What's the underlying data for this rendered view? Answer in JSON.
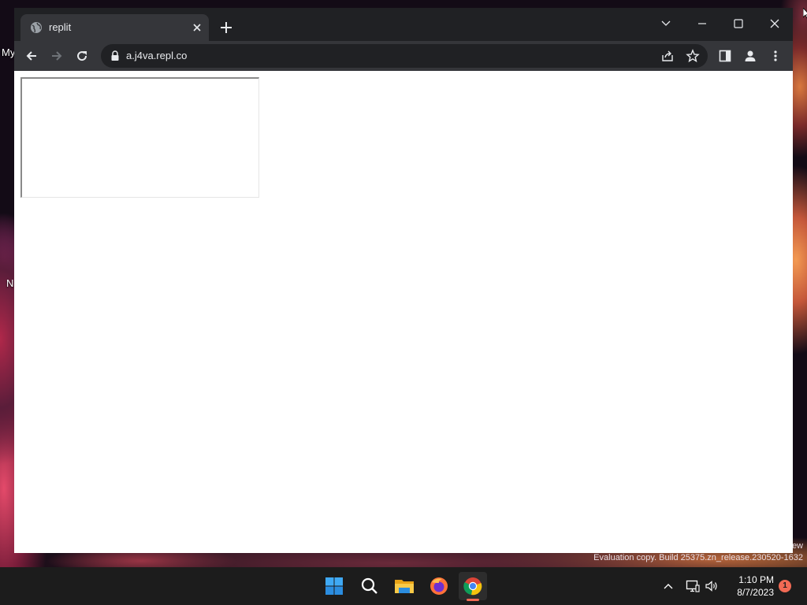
{
  "desktop": {
    "labels": [
      "My",
      "N"
    ],
    "watermark_line1": "ew",
    "watermark_line2": "Evaluation copy. Build 25375.zn_release.230520-1632"
  },
  "browser": {
    "tab": {
      "title": "replit",
      "favicon": "globe-icon",
      "close_icon": "close-icon"
    },
    "new_tab_icon": "plus-icon",
    "window_controls": [
      "chevron-down-icon",
      "minimize-icon",
      "maximize-icon",
      "close-icon"
    ],
    "toolbar": {
      "back_icon": "arrow-left-icon",
      "forward_icon": "arrow-right-icon",
      "reload_icon": "reload-icon",
      "url": "a.j4va.repl.co",
      "lock_icon": "lock-icon",
      "share_icon": "share-icon",
      "bookmark_icon": "star-icon",
      "side_panel_icon": "side-panel-icon",
      "profile_icon": "profile-icon",
      "menu_icon": "kebab-menu-icon"
    }
  },
  "taskbar": {
    "apps": [
      "windows-start-icon",
      "search-icon",
      "file-explorer-icon",
      "firefox-icon",
      "chrome-icon"
    ],
    "active_app": "chrome-icon",
    "tray_icons": [
      "chevron-up-icon",
      "network-icon",
      "volume-icon"
    ],
    "time": "1:10 PM",
    "date": "8/7/2023",
    "notification_count": "1"
  },
  "colors": {
    "titlebar": "#202124",
    "toolbar": "#35363a",
    "taskbar": "#1c1c1c",
    "accent": "#f26a54"
  }
}
